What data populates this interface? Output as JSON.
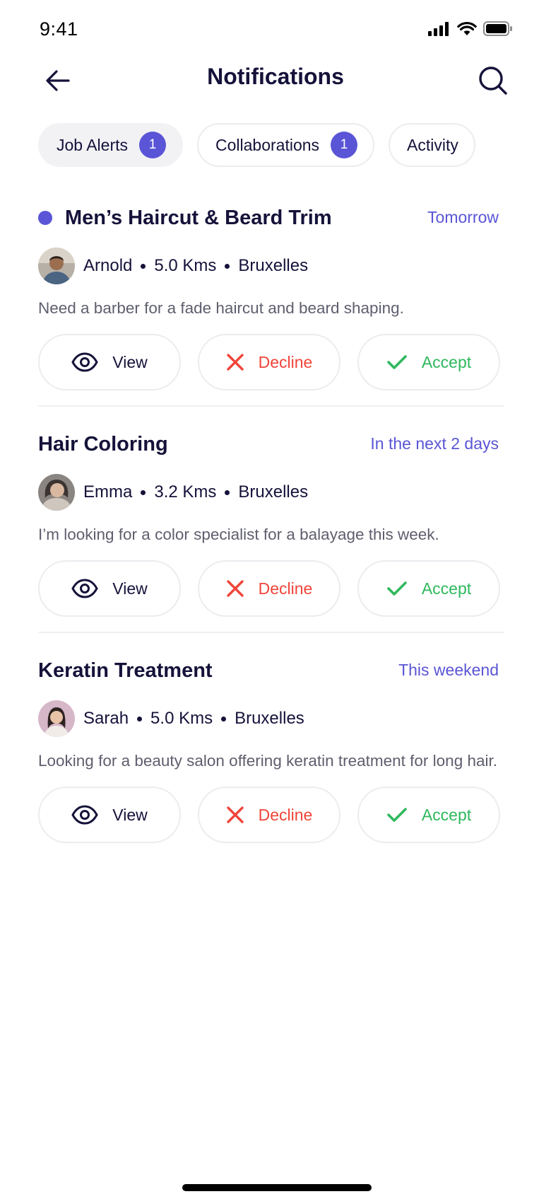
{
  "status_bar": {
    "time": "9:41"
  },
  "header": {
    "title": "Notifications"
  },
  "tabs": [
    {
      "label": "Job Alerts",
      "badge": "1"
    },
    {
      "label": "Collaborations",
      "badge": "1"
    },
    {
      "label": "Activity"
    }
  ],
  "notifications": [
    {
      "title": "Men’s Haircut & Beard Trim",
      "when": "Tomorrow",
      "name": "Arnold",
      "distance": "5.0 Kms",
      "city": "Bruxelles",
      "description": "Need a barber for a fade haircut and beard shaping."
    },
    {
      "title": "Hair Coloring",
      "when": "In the next 2 days",
      "name": "Emma",
      "distance": "3.2 Kms",
      "city": "Bruxelles",
      "description": "I’m looking for a color specialist for a balayage this week."
    },
    {
      "title": "Keratin Treatment",
      "when": "This weekend",
      "name": "Sarah",
      "distance": "5.0 Kms",
      "city": "Bruxelles",
      "description": "Looking for a beauty salon offering keratin treatment for long hair."
    }
  ],
  "actions": {
    "view": "View",
    "decline": "Decline",
    "accept": "Accept"
  },
  "colors": {
    "accent": "#5a55d6",
    "decline": "#f0443a",
    "accept": "#2fb85d",
    "text": "#15123a",
    "muted": "#5e5e6e"
  }
}
